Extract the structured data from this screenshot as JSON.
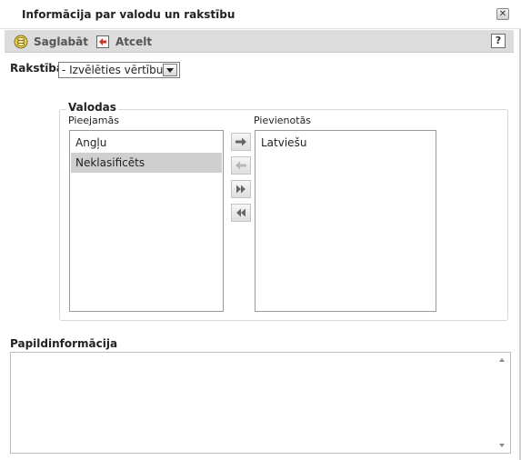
{
  "dialog": {
    "title": "Informācija par valodu un rakstību",
    "close_icon": "close-icon"
  },
  "toolbar": {
    "save_label": "Saglabāt",
    "save_icon": "save-icon",
    "cancel_label": "Atcelt",
    "cancel_icon": "cancel-icon",
    "help_label": "?"
  },
  "script_field": {
    "label": "Rakstība",
    "selected_value": "- Izvēlēties vērtību -"
  },
  "languages": {
    "legend": "Valodas",
    "available_label": "Pieejamās",
    "added_label": "Pievienotās",
    "available_items": [
      "Angļu",
      "Neklasificēts"
    ],
    "selected_available_index": 1,
    "added_items": [
      "Latviešu"
    ],
    "buttons": [
      "move-right-icon",
      "move-left-icon",
      "move-all-right-icon",
      "move-all-left-icon"
    ]
  },
  "additional_info": {
    "label": "Papildinformācija",
    "value": ""
  },
  "colors": {
    "toolbar_bg": "#dcdcdc",
    "selected_item_bg": "#cfcfcf",
    "border": "#9a9a9a"
  }
}
